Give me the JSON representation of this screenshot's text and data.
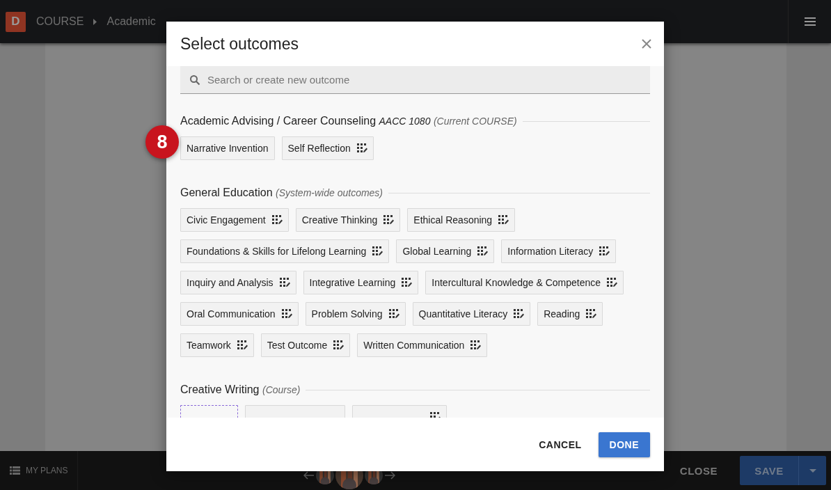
{
  "topbar": {
    "logo": "D",
    "breadcrumb": [
      "COURSE",
      "Academic"
    ]
  },
  "modal": {
    "title": "Select outcomes",
    "search": {
      "placeholder": "Search or create new outcome"
    },
    "badge": "8",
    "sections": [
      {
        "title": "Academic Advising / Career Counseling",
        "code": "AACC 1080",
        "note": "(Current COURSE)",
        "outcomes": [
          {
            "kind": "chip",
            "label": "Narrative Invention",
            "has_icon": false
          },
          {
            "kind": "chip",
            "label": "Self Reflection",
            "has_icon": true
          }
        ]
      },
      {
        "title": "General Education",
        "note": "(System-wide outcomes)",
        "outcomes": [
          {
            "kind": "chip",
            "label": "Civic Engagement",
            "has_icon": true
          },
          {
            "kind": "chip",
            "label": "Creative Thinking",
            "has_icon": true
          },
          {
            "kind": "chip",
            "label": "Ethical Reasoning",
            "has_icon": true
          },
          {
            "kind": "chip",
            "label": "Foundations & Skills for Lifelong Learning",
            "has_icon": true
          },
          {
            "kind": "chip",
            "label": "Global Learning",
            "has_icon": true
          },
          {
            "kind": "chip",
            "label": "Information Literacy",
            "has_icon": true
          },
          {
            "kind": "chip",
            "label": "Inquiry and Analysis",
            "has_icon": true
          },
          {
            "kind": "chip",
            "label": "Integrative Learning",
            "has_icon": true
          },
          {
            "kind": "chip",
            "label": "Intercultural Knowledge & Competence",
            "has_icon": true
          },
          {
            "kind": "chip",
            "label": "Oral Communication",
            "has_icon": true
          },
          {
            "kind": "chip",
            "label": "Problem Solving",
            "has_icon": true
          },
          {
            "kind": "chip",
            "label": "Quantitative Literacy",
            "has_icon": true
          },
          {
            "kind": "chip",
            "label": "Reading",
            "has_icon": true
          },
          {
            "kind": "chip",
            "label": "Teamwork",
            "has_icon": true
          },
          {
            "kind": "chip",
            "label": "Test Outcome",
            "has_icon": true
          },
          {
            "kind": "chip",
            "label": "Written Communication",
            "has_icon": true
          }
        ]
      },
      {
        "title": "Creative Writing",
        "note": "(Course)",
        "outcomes": [
          {
            "kind": "new"
          },
          {
            "kind": "cut"
          },
          {
            "kind": "cut_icon"
          }
        ]
      }
    ],
    "buttons": [
      {
        "kind": "text",
        "label": "CANCEL"
      },
      {
        "kind": "primary",
        "label": "DONE"
      }
    ]
  },
  "bottombar": {
    "plans": "MY PLANS",
    "close": "CLOSE",
    "save": "SAVE"
  }
}
